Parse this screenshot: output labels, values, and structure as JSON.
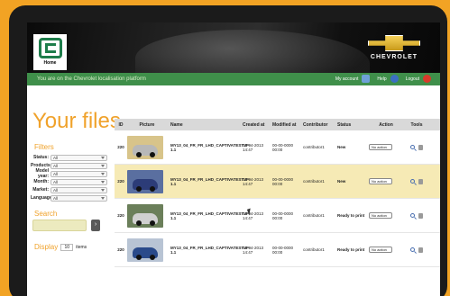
{
  "header": {
    "home_label": "Home",
    "brand_name": "CHEVROLET",
    "platform_message": "You are on the Chevrolet localisation platform",
    "my_account": "My account",
    "help": "Help",
    "logout": "Logout"
  },
  "page": {
    "title": "Your files"
  },
  "filters": {
    "heading": "Filters",
    "items": [
      {
        "label": "Status:",
        "value": "All"
      },
      {
        "label": "Products:",
        "value": "All"
      },
      {
        "label": "Model year:",
        "value": "All"
      },
      {
        "label": "Month:",
        "value": "All"
      },
      {
        "label": "Market:",
        "value": "All"
      },
      {
        "label": "Language:",
        "value": "All"
      }
    ]
  },
  "search": {
    "heading": "Search",
    "button_icon": "arrow-right-icon"
  },
  "display": {
    "label": "Display",
    "value": "10",
    "unit": "items"
  },
  "table": {
    "columns": [
      "ID",
      "Picture",
      "Name",
      "Created at",
      "Modified at",
      "Contributor",
      "Status",
      "Action",
      "Tools"
    ],
    "rows": [
      {
        "id": "220",
        "name": "MY13_04_FR_FR_LHD_CAPTIVATESTVF-1.1",
        "created": "02-04-2013 14:47",
        "modified": "00-00-0000 00:00",
        "contributor": "contributor1",
        "status": "New",
        "action": "No action",
        "thumb_color": "#d8c48a",
        "car_color": "#b8b8b8"
      },
      {
        "id": "220",
        "name": "MY13_04_FR_FR_LHD_CAPTIVATESTVF-1.1",
        "created": "02-04-2013 14:47",
        "modified": "00-00-0000 00:00",
        "contributor": "contributor1",
        "status": "New",
        "action": "No action",
        "thumb_color": "#5a6fa0",
        "car_color": "#2c3c78"
      },
      {
        "id": "220",
        "name": "MY13_04_FR_FR_LHD_CAPTIVATESTVF-1.1",
        "created": "02-04-2013 14:47",
        "modified": "00-00-0000 00:00",
        "contributor": "contributor1",
        "status": "Ready to print",
        "action": "No action",
        "thumb_color": "#6b7f5a",
        "car_color": "#d0d0d0"
      },
      {
        "id": "220",
        "name": "MY13_04_FR_FR_LHD_CAPTIVATESTVF-1.1",
        "created": "02-04-2013 14:47",
        "modified": "00-00-0000 00:00",
        "contributor": "contributor1",
        "status": "Ready to print",
        "action": "No action",
        "thumb_color": "#b8c4d4",
        "car_color": "#2a4a8a"
      }
    ]
  }
}
